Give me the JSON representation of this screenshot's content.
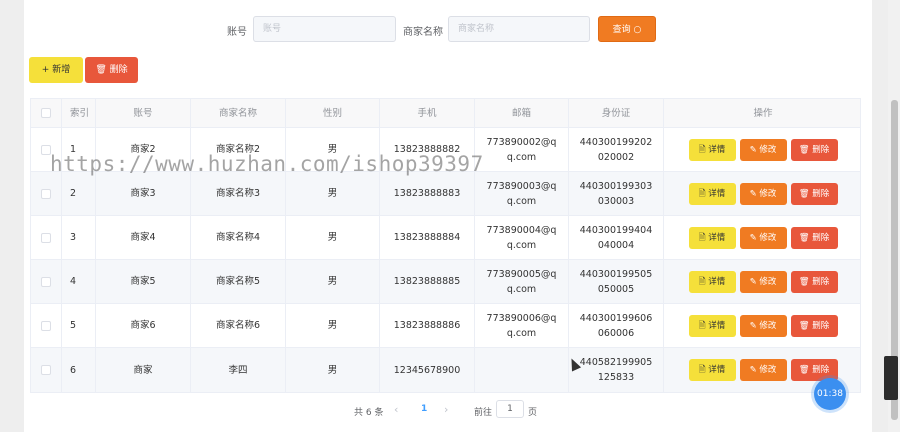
{
  "search": {
    "account_label": "账号",
    "account_placeholder": "账号",
    "merchant_label": "商家名称",
    "merchant_placeholder": "商家名称",
    "query_label": "查询 ○"
  },
  "toolbar": {
    "add_label": "+ 新增",
    "delete_label": "🗑 删除"
  },
  "table": {
    "headers": [
      "",
      "索引",
      "账号",
      "商家名称",
      "性别",
      "手机",
      "邮箱",
      "身份证",
      "操作"
    ],
    "rows": [
      {
        "index": "1",
        "account": "商家2",
        "merchant": "商家名称2",
        "gender": "男",
        "phone": "13823888882",
        "email": "773890002@qq.com",
        "id_card": "440300199202020002"
      },
      {
        "index": "2",
        "account": "商家3",
        "merchant": "商家名称3",
        "gender": "男",
        "phone": "13823888883",
        "email": "773890003@qq.com",
        "id_card": "440300199303030003"
      },
      {
        "index": "3",
        "account": "商家4",
        "merchant": "商家名称4",
        "gender": "男",
        "phone": "13823888884",
        "email": "773890004@qq.com",
        "id_card": "440300199404040004"
      },
      {
        "index": "4",
        "account": "商家5",
        "merchant": "商家名称5",
        "gender": "男",
        "phone": "13823888885",
        "email": "773890005@qq.com",
        "id_card": "440300199505050005"
      },
      {
        "index": "5",
        "account": "商家6",
        "merchant": "商家名称6",
        "gender": "男",
        "phone": "13823888886",
        "email": "773890006@qq.com",
        "id_card": "440300199606060006"
      },
      {
        "index": "6",
        "account": "商家",
        "merchant": "李四",
        "gender": "男",
        "phone": "12345678900",
        "email": "",
        "id_card": "440582199905125833"
      }
    ],
    "actions": {
      "detail": "🗎 详情",
      "edit": "✎ 修改",
      "delete": "🗑 删除"
    }
  },
  "pagination": {
    "total": "共 6 条",
    "prev": "‹",
    "current": "1",
    "next": "›",
    "goto_label": "前往",
    "goto_value": "1",
    "page_suffix": "页"
  },
  "watermark": "https://www.huzhan.com/ishop39397",
  "timer": "01:38"
}
